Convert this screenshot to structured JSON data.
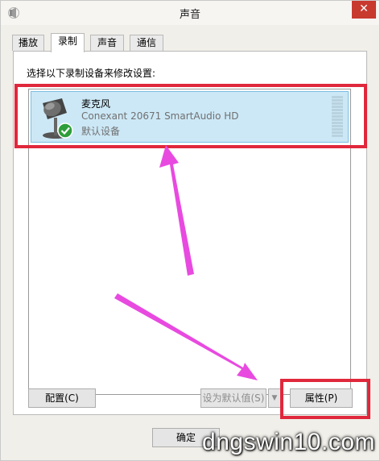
{
  "window": {
    "title": "声音"
  },
  "tabs": [
    {
      "label": "播放"
    },
    {
      "label": "录制"
    },
    {
      "label": "声音"
    },
    {
      "label": "通信"
    }
  ],
  "panel": {
    "instruction": "选择以下录制设备来修改设置:"
  },
  "devices": [
    {
      "name": "麦克风",
      "description": "Conexant 20671 SmartAudio HD",
      "status": "默认设备",
      "icon": "microphone-icon",
      "status_icon": "check-icon"
    }
  ],
  "buttons": {
    "configure": "配置(C)",
    "set_default": "设为默认值(S)",
    "properties": "属性(P)",
    "ok": "确定"
  },
  "watermark": "dngswin10.com",
  "colors": {
    "highlight": "#e0283c",
    "arrow": "#e84ae0",
    "selection": "#cce8f6",
    "close": "#c8392e"
  }
}
